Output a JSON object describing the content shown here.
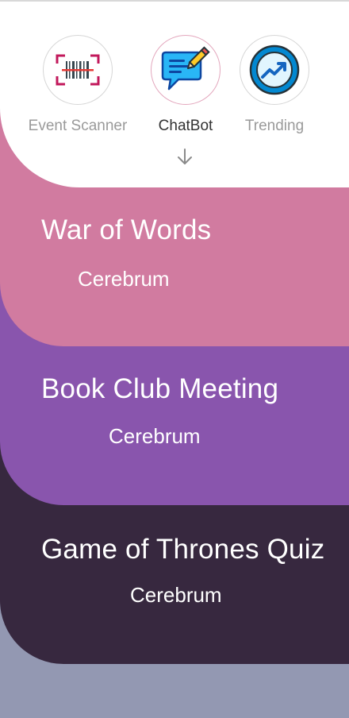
{
  "quick_actions": [
    {
      "label": "Event Scanner",
      "icon": "barcode-scanner-icon",
      "active": false
    },
    {
      "label": "ChatBot",
      "icon": "chat-bubble-icon",
      "active": true
    },
    {
      "label": "Trending",
      "icon": "trending-up-icon",
      "active": false
    }
  ],
  "indicator_icon": "arrow-down-icon",
  "events": [
    {
      "title": "War of Words",
      "organizer": "Cerebrum",
      "color": "#d17ba0"
    },
    {
      "title": "Book Club Meeting",
      "organizer": "Cerebrum",
      "color": "#8955ad"
    },
    {
      "title": "Game of Thrones Quiz",
      "organizer": "Cerebrum",
      "color": "#37283f"
    }
  ],
  "colors": {
    "background": "#9398b2",
    "header": "#ffffff",
    "active_label": "#333333",
    "inactive_label": "#9a9a9a"
  }
}
